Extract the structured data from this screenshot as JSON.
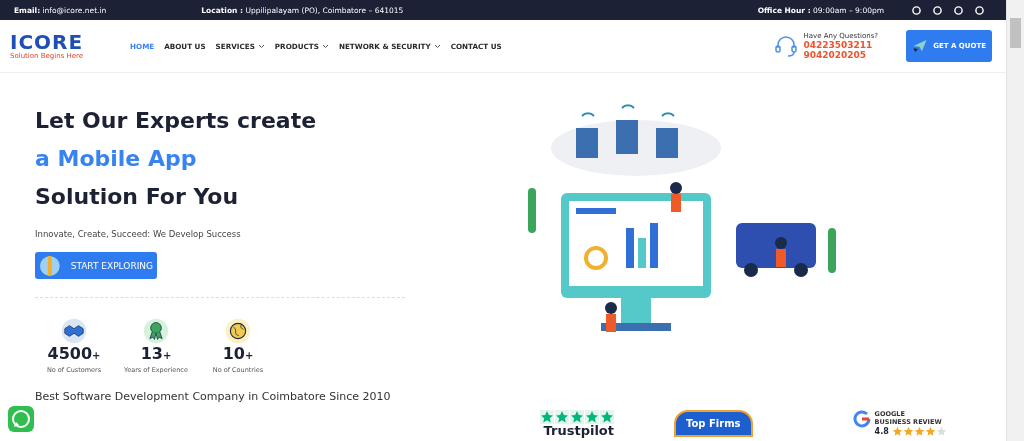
{
  "top_bar": {
    "email_label": "Email:",
    "email": "info@icore.net.in",
    "location_label": "Location :",
    "location": "Uppilipalayam (PO), Coimbatore – 641015",
    "hours_label": "Office Hour :",
    "hours": "09:00am – 9:00pm"
  },
  "logo": {
    "name": "ICORE",
    "tagline": "Solution Begins Here"
  },
  "nav": [
    {
      "label": "HOME",
      "selected": true,
      "dropdown": false
    },
    {
      "label": "ABOUT US",
      "selected": false,
      "dropdown": false
    },
    {
      "label": "SERVICES",
      "selected": false,
      "dropdown": true
    },
    {
      "label": "PRODUCTS",
      "selected": false,
      "dropdown": true
    },
    {
      "label": "NETWORK & SECURITY",
      "selected": false,
      "dropdown": true
    },
    {
      "label": "CONTACT US",
      "selected": false,
      "dropdown": false
    }
  ],
  "contact": {
    "question": "Have Any Questions?",
    "phones": [
      "04223503211",
      "9042020205"
    ]
  },
  "quote_button": "GET A QUOTE",
  "hero": {
    "line_1": "Let Our Experts create",
    "line_2": "a Mobile App",
    "line_3": "Solution For You",
    "subtitle": "Innovate, Create, Succeed: We Develop Success",
    "button": "START EXPLORING"
  },
  "stats": [
    {
      "kind": "handshake",
      "value": "4500",
      "suffix": "+",
      "label": "No of Customers"
    },
    {
      "kind": "award",
      "value": "13",
      "suffix": "+",
      "label": "Years of Experience"
    },
    {
      "kind": "globe",
      "value": "10",
      "suffix": "+",
      "label": "No of Countries"
    }
  ],
  "tagline": "Best Software Development Company in Coimbatore Since 2010",
  "badges": {
    "trustpilot": {
      "name": "Trustpilot",
      "stars": 5
    },
    "top_firms": {
      "name": "Top Firms"
    },
    "google": {
      "line_1": "GOOGLE",
      "line_2": "BUSINESS REVIEW",
      "rating": "4.8",
      "stars": 4
    }
  }
}
